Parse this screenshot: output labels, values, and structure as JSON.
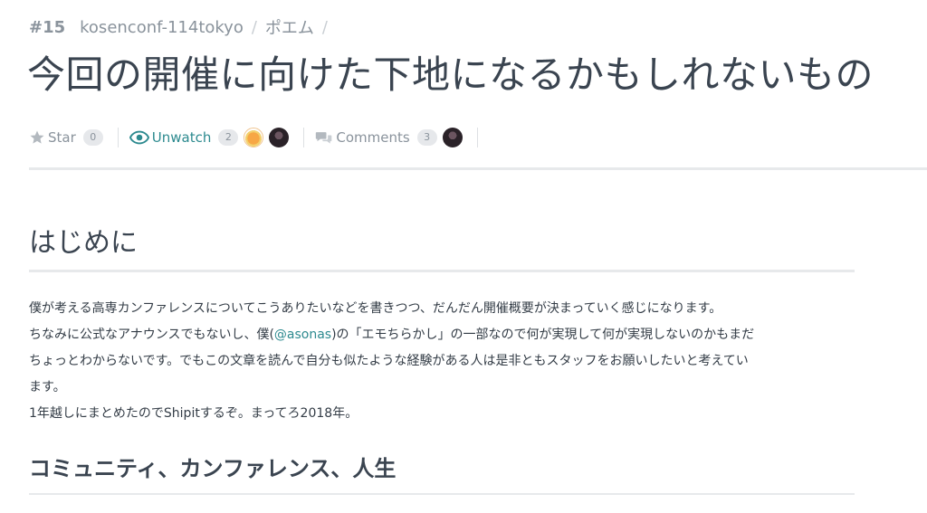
{
  "breadcrumb": {
    "number": "#15",
    "team": "kosenconf-114tokyo",
    "category": "ポエム",
    "separator": "/"
  },
  "title": "今回の開催に向けた下地になるかもしれないもの",
  "actions": {
    "star_label": "Star",
    "star_count": "0",
    "unwatch_label": "Unwatch",
    "watch_count": "2",
    "comments_label": "Comments",
    "comments_count": "3"
  },
  "content": {
    "heading": "はじめに",
    "paragraph": {
      "line1": "僕が考える高専カンファレンスについてこうありたいなどを書きつつ、だんだん開催概要が決まっていく感じになります。",
      "line2_before": "ちなみに公式なアナウンスでもないし、僕(",
      "mention": "@asonas",
      "line2_after": ")の「エモちらかし」の一部なので何が実現して何が実現しないのかもまだ",
      "line3": "ちょっとわからないです。でもこの文章を読んで自分も似たような経験がある人は是非ともスタッフをお願いしたいと考えてい",
      "line4": "ます。",
      "line5": "1年越しにまとめたのでShipitするぞ。まってろ2018年。"
    },
    "subheading": "コミュニティ、カンファレンス、人生"
  },
  "icons": {
    "star": "star-icon",
    "watch": "eye-icon",
    "comments": "speech-bubbles-icon"
  },
  "colors": {
    "accent": "#2d8a8f",
    "muted": "#8a939c",
    "title": "#3a4450",
    "badge_bg": "#e6e8eb"
  }
}
